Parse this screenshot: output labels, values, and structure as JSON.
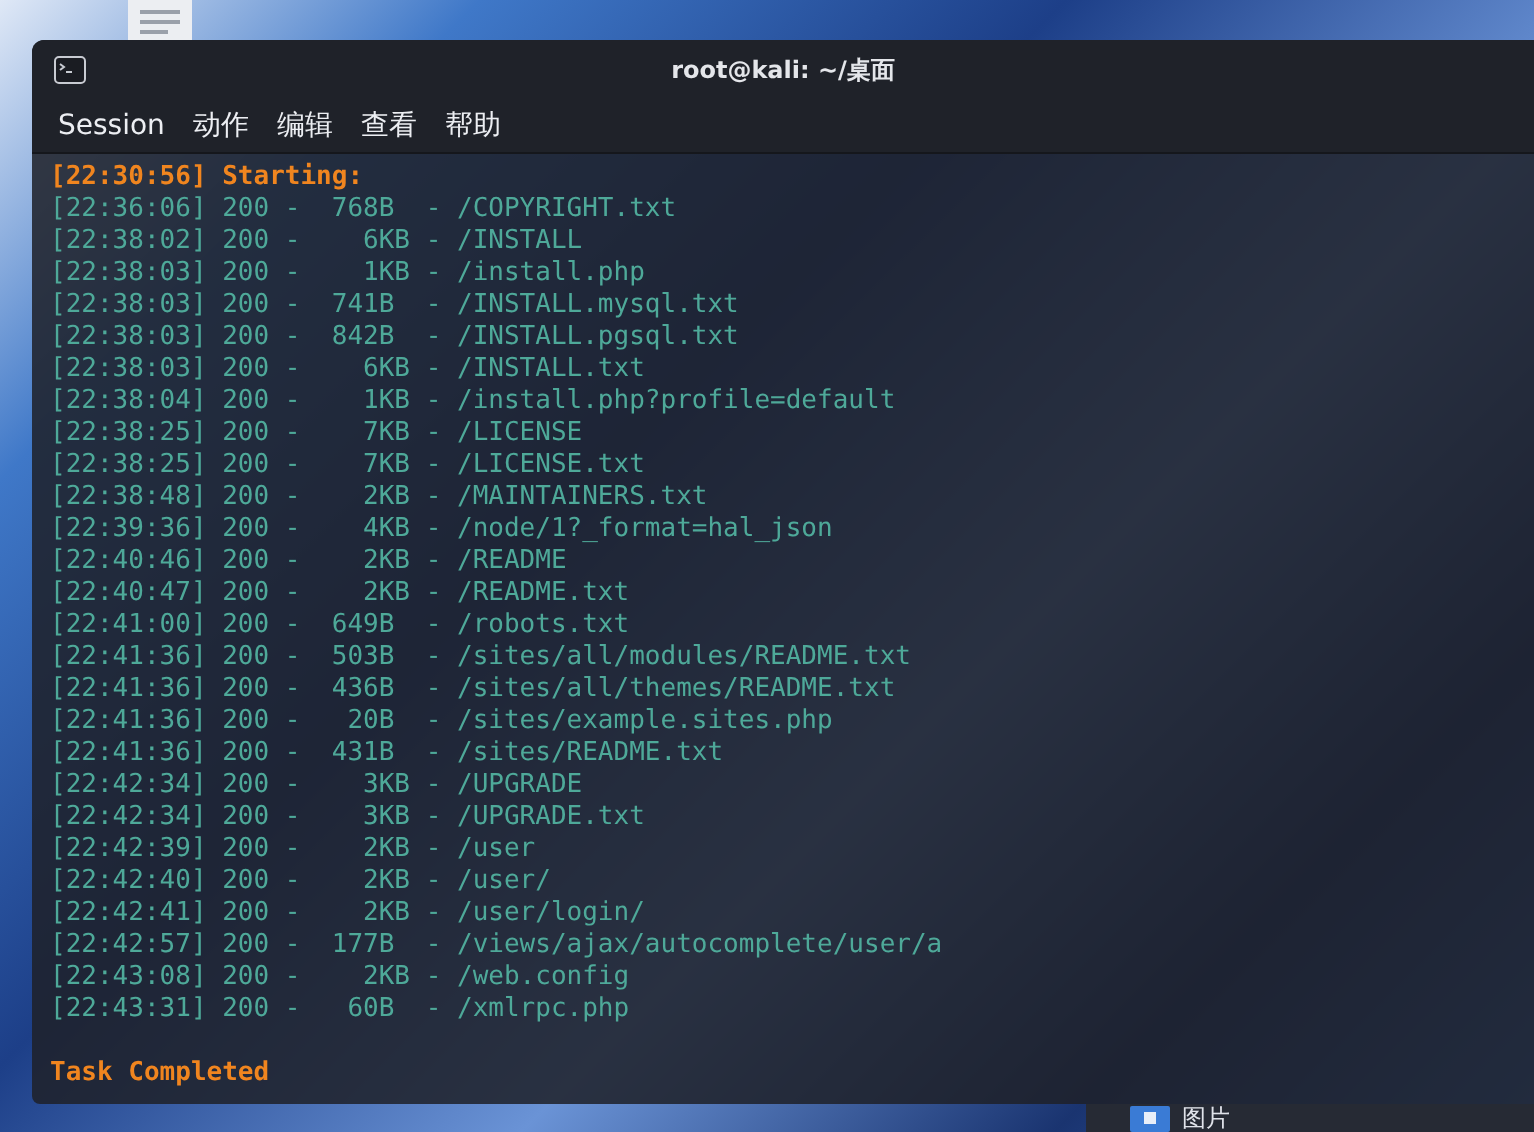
{
  "file_manager": {
    "places": [
      {
        "label": "图片"
      }
    ]
  },
  "window": {
    "title": "root@kali: ~/桌面"
  },
  "menu": [
    "Session",
    "动作",
    "编辑",
    "查看",
    "帮助"
  ],
  "lines": [
    {
      "kind": "header",
      "text": "[22:30:56] Starting:"
    },
    {
      "kind": "result",
      "text": "[22:36:06] 200 -  768B  - /COPYRIGHT.txt"
    },
    {
      "kind": "result",
      "text": "[22:38:02] 200 -    6KB - /INSTALL"
    },
    {
      "kind": "result",
      "text": "[22:38:03] 200 -    1KB - /install.php"
    },
    {
      "kind": "result",
      "text": "[22:38:03] 200 -  741B  - /INSTALL.mysql.txt"
    },
    {
      "kind": "result",
      "text": "[22:38:03] 200 -  842B  - /INSTALL.pgsql.txt"
    },
    {
      "kind": "result",
      "text": "[22:38:03] 200 -    6KB - /INSTALL.txt"
    },
    {
      "kind": "result",
      "text": "[22:38:04] 200 -    1KB - /install.php?profile=default"
    },
    {
      "kind": "result",
      "text": "[22:38:25] 200 -    7KB - /LICENSE"
    },
    {
      "kind": "result",
      "text": "[22:38:25] 200 -    7KB - /LICENSE.txt"
    },
    {
      "kind": "result",
      "text": "[22:38:48] 200 -    2KB - /MAINTAINERS.txt"
    },
    {
      "kind": "result",
      "text": "[22:39:36] 200 -    4KB - /node/1?_format=hal_json"
    },
    {
      "kind": "result",
      "text": "[22:40:46] 200 -    2KB - /README"
    },
    {
      "kind": "result",
      "text": "[22:40:47] 200 -    2KB - /README.txt"
    },
    {
      "kind": "result",
      "text": "[22:41:00] 200 -  649B  - /robots.txt"
    },
    {
      "kind": "result",
      "text": "[22:41:36] 200 -  503B  - /sites/all/modules/README.txt"
    },
    {
      "kind": "result",
      "text": "[22:41:36] 200 -  436B  - /sites/all/themes/README.txt"
    },
    {
      "kind": "result",
      "text": "[22:41:36] 200 -   20B  - /sites/example.sites.php"
    },
    {
      "kind": "result",
      "text": "[22:41:36] 200 -  431B  - /sites/README.txt"
    },
    {
      "kind": "result",
      "text": "[22:42:34] 200 -    3KB - /UPGRADE"
    },
    {
      "kind": "result",
      "text": "[22:42:34] 200 -    3KB - /UPGRADE.txt"
    },
    {
      "kind": "result",
      "text": "[22:42:39] 200 -    2KB - /user"
    },
    {
      "kind": "result",
      "text": "[22:42:40] 200 -    2KB - /user/"
    },
    {
      "kind": "result",
      "text": "[22:42:41] 200 -    2KB - /user/login/"
    },
    {
      "kind": "result",
      "text": "[22:42:57] 200 -  177B  - /views/ajax/autocomplete/user/a"
    },
    {
      "kind": "result",
      "text": "[22:43:08] 200 -    2KB - /web.config"
    },
    {
      "kind": "result",
      "text": "[22:43:31] 200 -   60B  - /xmlrpc.php"
    },
    {
      "kind": "footer",
      "text": "Task Completed"
    }
  ]
}
